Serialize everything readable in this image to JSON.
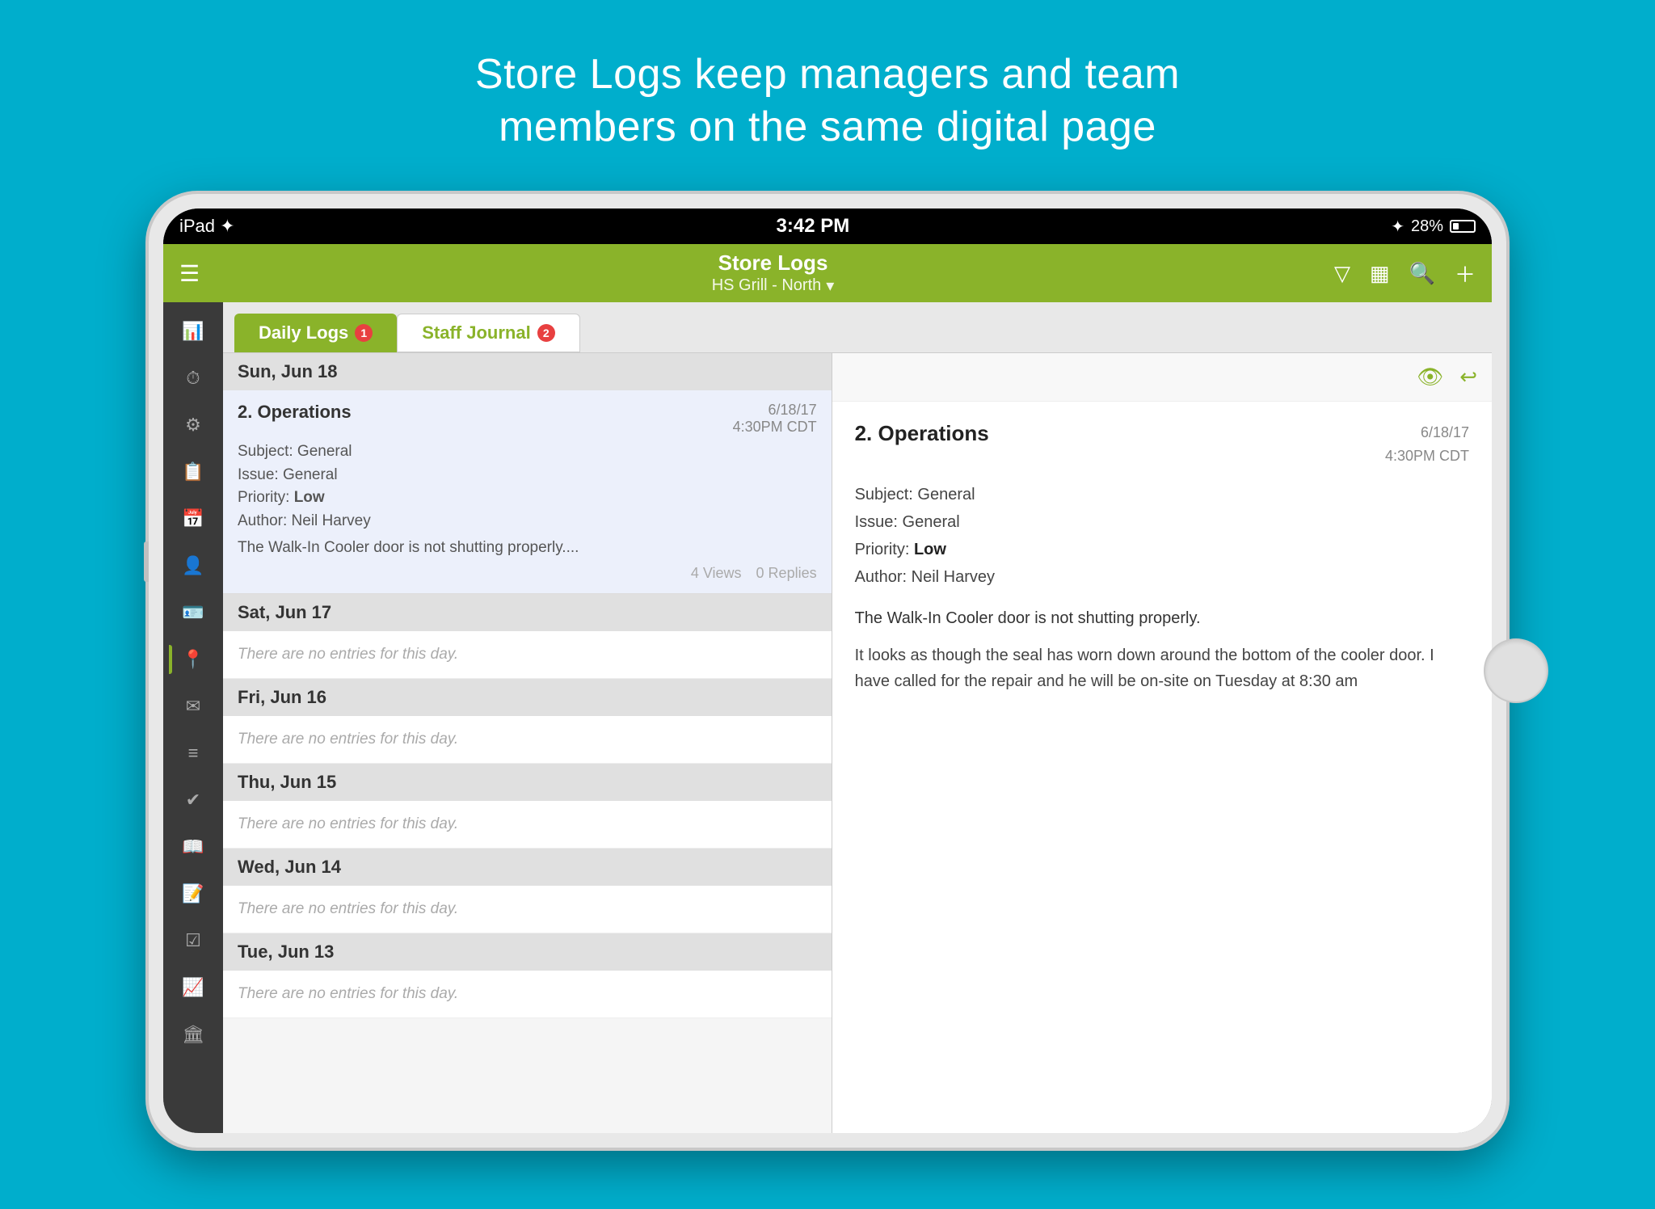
{
  "headline": {
    "line1": "Store Logs keep managers and team",
    "line2": "members on the same digital page"
  },
  "status_bar": {
    "left": "iPad  ✦",
    "time": "3:42 PM",
    "right_bluetooth": "✦",
    "right_percent": "28%"
  },
  "toolbar": {
    "title": "Store Logs",
    "subtitle": "HS Grill - North",
    "menu_icon": "☰"
  },
  "tabs": [
    {
      "label": "Daily Logs",
      "badge": "1",
      "active": true
    },
    {
      "label": "Staff Journal",
      "badge": "2",
      "active": false
    }
  ],
  "sidebar_icons": [
    {
      "name": "bar-chart-icon",
      "glyph": "📊",
      "active": false
    },
    {
      "name": "clock-icon",
      "glyph": "🕐",
      "active": false
    },
    {
      "name": "settings-icon",
      "glyph": "⚙",
      "active": false
    },
    {
      "name": "calendar-list-icon",
      "glyph": "📋",
      "active": false
    },
    {
      "name": "calendar-icon",
      "glyph": "📅",
      "active": false
    },
    {
      "name": "person-circle-icon",
      "glyph": "👤",
      "active": false
    },
    {
      "name": "id-card-icon",
      "glyph": "🪪",
      "active": false
    },
    {
      "name": "pin-icon",
      "glyph": "📍",
      "active": true
    },
    {
      "name": "mail-icon",
      "glyph": "✉",
      "active": false
    },
    {
      "name": "list-icon",
      "glyph": "≡",
      "active": false
    },
    {
      "name": "check-circle-icon",
      "glyph": "✅",
      "active": false
    },
    {
      "name": "book-icon",
      "glyph": "📖",
      "active": false
    },
    {
      "name": "task-list-icon",
      "glyph": "📝",
      "active": false
    },
    {
      "name": "check-square-icon",
      "glyph": "☑",
      "active": false
    },
    {
      "name": "trend-icon",
      "glyph": "📈",
      "active": false
    },
    {
      "name": "building-icon",
      "glyph": "🏛",
      "active": false
    }
  ],
  "log_days": [
    {
      "day_label": "Sun, Jun 18",
      "entries": [
        {
          "title": "2. Operations",
          "date": "6/18/17",
          "time": "4:30PM CDT",
          "subject": "General",
          "issue": "General",
          "priority": "Low",
          "author": "Neil Harvey",
          "preview": "The Walk-In Cooler door is not shutting properly....",
          "views": "4 Views",
          "replies": "0 Replies"
        }
      ]
    },
    {
      "day_label": "Sat, Jun 17",
      "entries": []
    },
    {
      "day_label": "Fri, Jun 16",
      "entries": []
    },
    {
      "day_label": "Thu, Jun 15",
      "entries": []
    },
    {
      "day_label": "Wed, Jun 14",
      "entries": []
    },
    {
      "day_label": "Tue, Jun 13",
      "entries": []
    }
  ],
  "empty_day_text": "There are no entries for this day.",
  "detail": {
    "title": "2. Operations",
    "date": "6/18/17",
    "time": "4:30PM CDT",
    "subject_label": "Subject:",
    "subject_value": "General",
    "issue_label": "Issue:",
    "issue_value": "General",
    "priority_label": "Priority:",
    "priority_value": "Low",
    "author_label": "Author:",
    "author_value": "Neil Harvey",
    "body1": "The Walk-In Cooler door is not shutting properly.",
    "body2": "It looks as though the seal has worn down around the bottom of the cooler door.  I have called for the repair and he will be on-site on Tuesday at 8:30 am"
  }
}
